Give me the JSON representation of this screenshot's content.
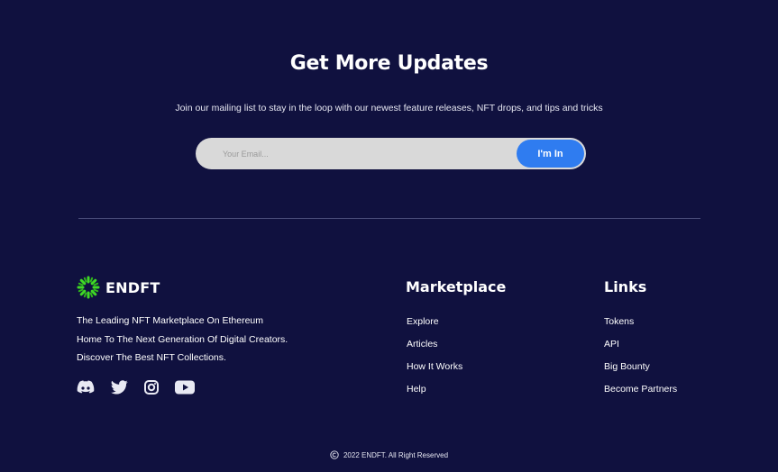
{
  "newsletter": {
    "title": "Get More Updates",
    "subtitle": "Join our mailing list to stay in the loop with our newest feature releases, NFT drops, and tips and tricks",
    "email_placeholder": "Your Email...",
    "email_value": "",
    "button_label": "I'm In"
  },
  "brand": {
    "name": "ENDFT",
    "logo_icon": "sunburst-logo-icon",
    "logo_color": "#3fd826",
    "tagline": [
      "The Leading NFT Marketplace On Ethereum",
      "Home To The Next Generation Of Digital Creators.",
      "Discover The Best NFT Collections."
    ]
  },
  "socials": [
    "discord-icon",
    "twitter-icon",
    "instagram-icon",
    "youtube-icon"
  ],
  "marketplace": {
    "title": "Marketplace",
    "items": [
      "Explore",
      "Articles",
      "How It Works",
      "Help"
    ]
  },
  "links": {
    "title": "Links",
    "items": [
      "Tokens",
      "API",
      "Big Bounty",
      "Become Partners"
    ]
  },
  "footer": {
    "copyright": "2022 ENDFT. All Right Reserved"
  },
  "colors": {
    "background": "#10113f",
    "accent": "#2f7cf0",
    "input_bg": "#d9d9d9",
    "divider": "#4a4d7a"
  }
}
